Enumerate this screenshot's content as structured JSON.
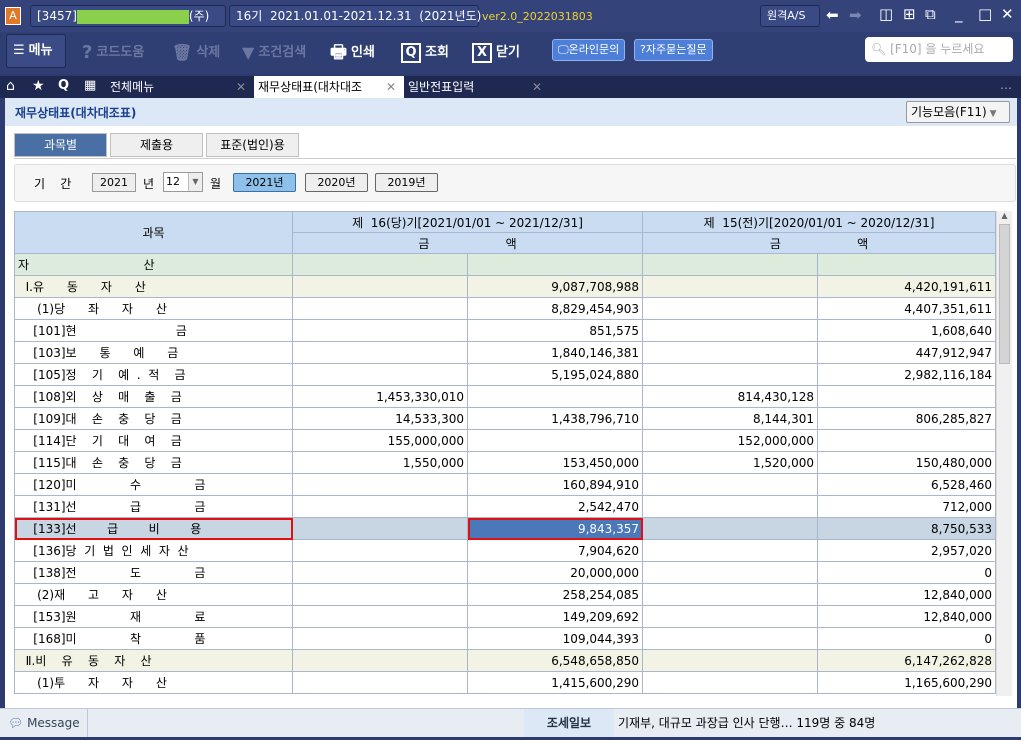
{
  "titlebar": {
    "app_icon": "A",
    "company": "[3457]",
    "company_suffix": "(주)",
    "period": "16기  2021.01.01-2021.12.31  (2021년도)",
    "version": "ver2.0_2022031803",
    "remote_as": "원격A/S"
  },
  "toolbar": {
    "menu": "메뉴",
    "code_help": "코드도움",
    "delete": "삭제",
    "cond_search": "조건검색",
    "print": "인쇄",
    "view": "조회",
    "close": "닫기",
    "online_inquiry": "온라인문의",
    "faq": "자주묻는질문",
    "search_placeholder": "[F10] 을 누르세요"
  },
  "tabs": [
    {
      "label": "전체메뉴"
    },
    {
      "label": "재무상태표(대차대조"
    },
    {
      "label": "일반전표입력"
    }
  ],
  "page": {
    "title": "재무상태표(대차대조표)",
    "function_menu": "기능모음(F11)"
  },
  "subtabs": [
    "과목별",
    "제출용",
    "표준(법인)용"
  ],
  "filter": {
    "period_label": "기    간",
    "year": "2021",
    "year_unit": "년",
    "month": "12",
    "month_unit": "월",
    "year_buttons": [
      "2021년",
      "2020년",
      "2019년"
    ]
  },
  "table": {
    "subject_header": "과목",
    "current_header": "제  16(당)기[2021/01/01 ~ 2021/12/31]",
    "prior_header": "제  15(전)기[2020/01/01 ~ 2020/12/31]",
    "amount_header": "금                    액",
    "group_label": "자                              산",
    "rows": [
      {
        "label": "  Ⅰ.유      동      자      산",
        "c1": "",
        "c2": "9,087,708,988",
        "c3": "",
        "c4": "4,420,191,611",
        "type": "sec"
      },
      {
        "label": "     (1)당      좌      자      산",
        "c1": "",
        "c2": "8,829,454,903",
        "c3": "",
        "c4": "4,407,351,611",
        "type": ""
      },
      {
        "label": "    [101]현                          금",
        "c1": "",
        "c2": "851,575",
        "c3": "",
        "c4": "1,608,640",
        "type": ""
      },
      {
        "label": "    [103]보      통      예      금",
        "c1": "",
        "c2": "1,840,146,381",
        "c3": "",
        "c4": "447,912,947",
        "type": ""
      },
      {
        "label": "    [105]정    기    예  .  적    금",
        "c1": "",
        "c2": "5,195,024,880",
        "c3": "",
        "c4": "2,982,116,184",
        "type": ""
      },
      {
        "label": "    [108]외    상    매    출    금",
        "c1": "1,453,330,010",
        "c2": "",
        "c3": "814,430,128",
        "c4": "",
        "type": ""
      },
      {
        "label": "    [109]대    손    충    당    금",
        "c1": "14,533,300",
        "c2": "1,438,796,710",
        "c3": "8,144,301",
        "c4": "806,285,827",
        "type": ""
      },
      {
        "label": "    [114]단    기    대    여    금",
        "c1": "155,000,000",
        "c2": "",
        "c3": "152,000,000",
        "c4": "",
        "type": ""
      },
      {
        "label": "    [115]대    손    충    당    금",
        "c1": "1,550,000",
        "c2": "153,450,000",
        "c3": "1,520,000",
        "c4": "150,480,000",
        "type": ""
      },
      {
        "label": "    [120]미              수              금",
        "c1": "",
        "c2": "160,894,910",
        "c3": "",
        "c4": "6,528,460",
        "type": ""
      },
      {
        "label": "    [131]선              급              금",
        "c1": "",
        "c2": "2,542,470",
        "c3": "",
        "c4": "712,000",
        "type": ""
      },
      {
        "label": "    [133]선        급        비        용",
        "c1": "",
        "c2": "9,843,357",
        "c3": "",
        "c4": "8,750,533",
        "type": "sel"
      },
      {
        "label": "    [136]당  기  법  인  세  자  산",
        "c1": "",
        "c2": "7,904,620",
        "c3": "",
        "c4": "2,957,020",
        "type": ""
      },
      {
        "label": "    [138]전              도              금",
        "c1": "",
        "c2": "20,000,000",
        "c3": "",
        "c4": "0",
        "type": ""
      },
      {
        "label": "     (2)재      고      자      산",
        "c1": "",
        "c2": "258,254,085",
        "c3": "",
        "c4": "12,840,000",
        "type": ""
      },
      {
        "label": "    [153]원              재              료",
        "c1": "",
        "c2": "149,209,692",
        "c3": "",
        "c4": "12,840,000",
        "type": ""
      },
      {
        "label": "    [168]미              착              품",
        "c1": "",
        "c2": "109,044,393",
        "c3": "",
        "c4": "0",
        "type": ""
      },
      {
        "label": "  Ⅱ.비    유    동    자    산",
        "c1": "",
        "c2": "6,548,658,850",
        "c3": "",
        "c4": "6,147,262,828",
        "type": "sec"
      },
      {
        "label": "     (1)투      자      자      산",
        "c1": "",
        "c2": "1,415,600,290",
        "c3": "",
        "c4": "1,165,600,290",
        "type": ""
      }
    ]
  },
  "status": {
    "message": "Message",
    "news_label": "조세일보",
    "news_text": "기재부, 대규모 과장급 인사 단행… 119명 중 84명"
  }
}
